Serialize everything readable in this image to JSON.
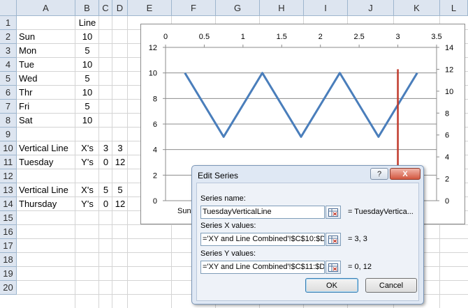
{
  "columns": [
    "A",
    "B",
    "C",
    "D",
    "E",
    "F",
    "G",
    "H",
    "I",
    "J",
    "K",
    "L"
  ],
  "rows": [
    "1",
    "2",
    "3",
    "4",
    "5",
    "6",
    "7",
    "8",
    "9",
    "10",
    "11",
    "12",
    "13",
    "14",
    "15",
    "16",
    "17",
    "18",
    "19",
    "20"
  ],
  "cells": {
    "b1": "Line",
    "a2": "Sun",
    "b2": "10",
    "a3": "Mon",
    "b3": "5",
    "a4": "Tue",
    "b4": "10",
    "a5": "Wed",
    "b5": "5",
    "a6": "Thr",
    "b6": "10",
    "a7": "Fri",
    "b7": "5",
    "a8": "Sat",
    "b8": "10",
    "a10": "Vertical Line",
    "b10": "X's",
    "c10": "3",
    "d10": "3",
    "a11": "Tuesday",
    "b11": "Y's",
    "c11": "0",
    "d11": "12",
    "a13": "Vertical Line",
    "b13": "X's",
    "c13": "5",
    "d13": "5",
    "a14": "Thursday",
    "b14": "Y's",
    "c14": "0",
    "d14": "12"
  },
  "chart_data": {
    "type": "line",
    "series": [
      {
        "name": "Line",
        "x": [
          0.25,
          0.75,
          1.25,
          1.75,
          2.25,
          2.75,
          3.25
        ],
        "values": [
          10,
          5,
          10,
          5,
          10,
          5,
          10
        ],
        "axis": "primary",
        "color": "#4a7ebb"
      },
      {
        "name": "TuesdayVerticalLine",
        "x": [
          3,
          3
        ],
        "values": [
          0,
          12
        ],
        "axis": "secondary",
        "color": "#c0392b"
      }
    ],
    "x_top_ticks": [
      "0",
      "0.5",
      "1",
      "1.5",
      "2",
      "2.5",
      "3",
      "3.5"
    ],
    "x_top_range": [
      0,
      3.5
    ],
    "y_left_ticks": [
      "0",
      "2",
      "4",
      "6",
      "8",
      "10",
      "12"
    ],
    "y_left_range": [
      0,
      12
    ],
    "y_right_ticks": [
      "0",
      "2",
      "4",
      "6",
      "8",
      "10",
      "12",
      "14"
    ],
    "y_right_range": [
      0,
      14
    ],
    "category_label_visible": "Sun",
    "grid": true
  },
  "dialog": {
    "title": "Edit Series",
    "help": "?",
    "close": "X",
    "name_label": "Series name:",
    "name_value": "TuesdayVerticalLine",
    "name_result": "= TuesdayVertica...",
    "x_label": "Series X values:",
    "x_value": "='XY and Line Combined'!$C$10:$D:",
    "x_result": "= 3, 3",
    "y_label": "Series Y values:",
    "y_value": "='XY and Line Combined'!$C$11:$D:",
    "y_result": "= 0, 12",
    "ok": "OK",
    "cancel": "Cancel"
  }
}
